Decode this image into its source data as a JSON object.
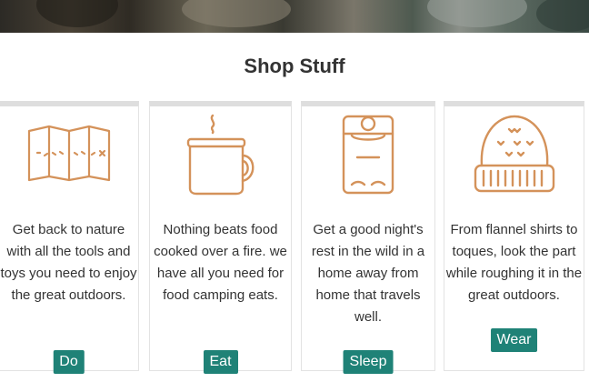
{
  "section": {
    "title": "Shop Stuff"
  },
  "colors": {
    "accent": "#1f8277",
    "icon_stroke": "#d4925a"
  },
  "cards": [
    {
      "icon": "map-icon",
      "description": "Get back to nature with all the tools and toys you need to enjoy the great outdoors.",
      "button": "Do"
    },
    {
      "icon": "mug-icon",
      "description": "Nothing beats food cooked over a fire. we have all you need for food camping eats.",
      "button": "Eat"
    },
    {
      "icon": "sleeping-bag-icon",
      "description": "Get a good night's rest in the wild in a home away from home that travels well.",
      "button": "Sleep"
    },
    {
      "icon": "beanie-icon",
      "description": "From flannel shirts to toques, look the part while roughing it in the great outdoors.",
      "button": "Wear"
    }
  ]
}
